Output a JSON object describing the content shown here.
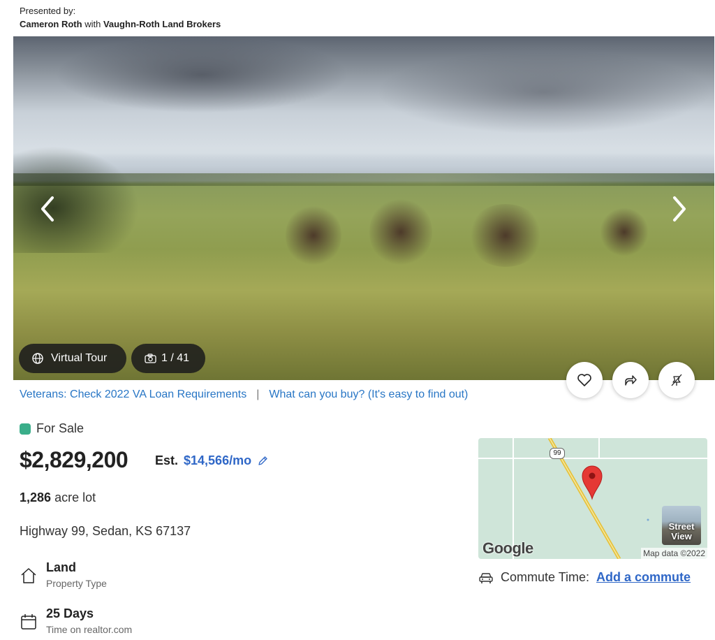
{
  "presented": {
    "label": "Presented by:",
    "agent": "Cameron Roth",
    "with": "with",
    "broker": "Vaughn-Roth Land Brokers"
  },
  "gallery": {
    "virtual_tour_label": "Virtual Tour",
    "photo_counter": "1 / 41",
    "prev_icon": "chevron-left-icon",
    "next_icon": "chevron-right-icon"
  },
  "actions": {
    "favorite_icon": "heart-icon",
    "share_icon": "share-icon",
    "hide_icon": "eye-off-icon"
  },
  "promo": {
    "link1": "Veterans: Check 2022 VA Loan Requirements",
    "separator": "|",
    "link2": "What can you buy? (It's easy to find out)"
  },
  "listing": {
    "status": "For Sale",
    "status_color": "#3aae8a",
    "price": "$2,829,200",
    "est_label": "Est.",
    "est_value": "$14,566/mo",
    "lot_size": "1,286",
    "lot_unit": "acre lot",
    "address": "Highway 99, Sedan, KS 67137"
  },
  "facts": [
    {
      "title": "Land",
      "sub": "Property Type",
      "icon": "house-outline-icon"
    },
    {
      "title": "25 Days",
      "sub": "Time on realtor.com",
      "icon": "calendar-icon"
    }
  ],
  "map": {
    "route_shield": "99",
    "logo": "Google",
    "attribution": "Map data ©2022",
    "street_view": "Street View"
  },
  "commute": {
    "label": "Commute Time:",
    "link": "Add a commute",
    "icon": "car-icon"
  },
  "colors": {
    "link": "#2876c5",
    "accent_blue": "#2f67c7"
  }
}
